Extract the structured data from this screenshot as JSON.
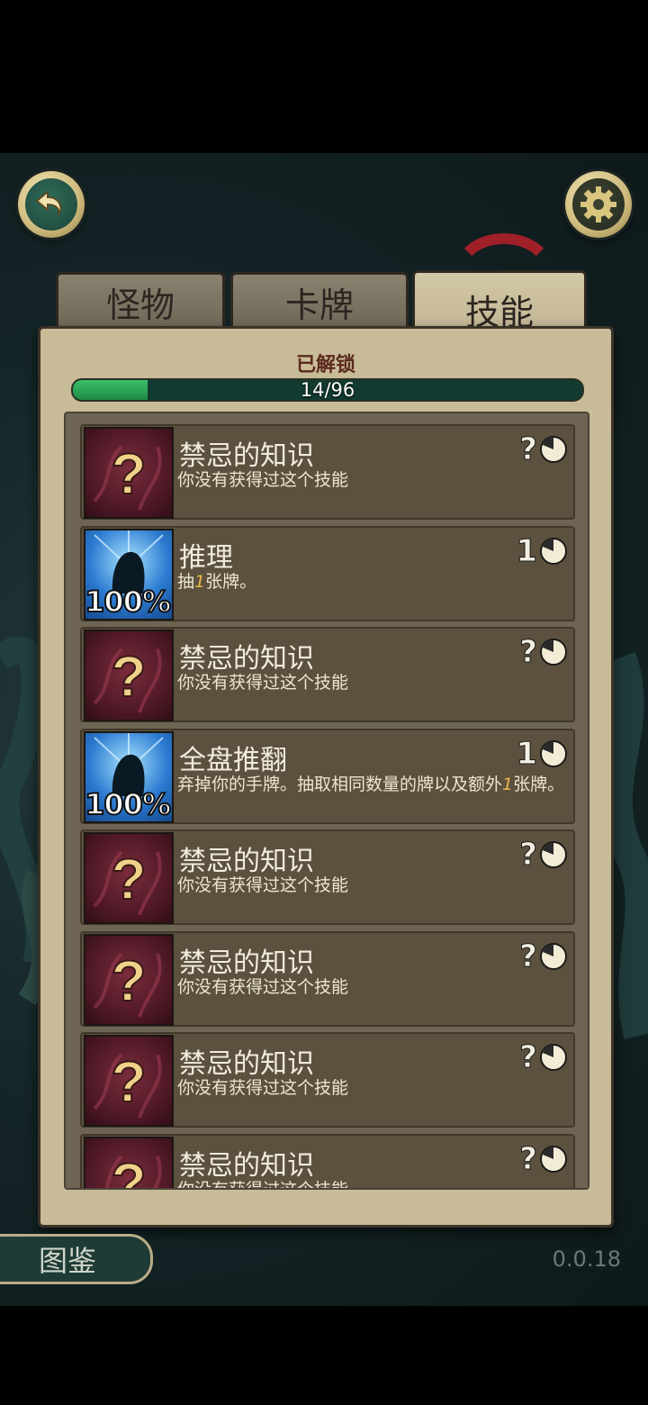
{
  "header": {
    "back_icon": "back-arrow-icon",
    "settings_icon": "gear-icon"
  },
  "tabs": [
    {
      "label": "怪物",
      "active": false
    },
    {
      "label": "卡牌",
      "active": false
    },
    {
      "label": "技能",
      "active": true
    }
  ],
  "unlock": {
    "label": "已解锁",
    "progress_text": "14/96",
    "progress_fraction": 0.146
  },
  "skills": [
    {
      "name": "禁忌的知识",
      "desc": "你没有获得过这个技能",
      "cost": "?",
      "locked": true
    },
    {
      "name": "推理",
      "desc_parts": [
        "抽",
        "1",
        "张牌。"
      ],
      "cost": "1",
      "percent": "100%",
      "locked": false
    },
    {
      "name": "禁忌的知识",
      "desc": "你没有获得过这个技能",
      "cost": "?",
      "locked": true
    },
    {
      "name": "全盘推翻",
      "desc_parts": [
        "弃掉你的手牌。抽取相同数量的牌以及额外",
        "1",
        "张牌。"
      ],
      "cost": "1",
      "percent": "100%",
      "locked": false
    },
    {
      "name": "禁忌的知识",
      "desc": "你没有获得过这个技能",
      "cost": "?",
      "locked": true
    },
    {
      "name": "禁忌的知识",
      "desc": "你没有获得过这个技能",
      "cost": "?",
      "locked": true
    },
    {
      "name": "禁忌的知识",
      "desc": "你没有获得过这个技能",
      "cost": "?",
      "locked": true
    },
    {
      "name": "禁忌的知识",
      "desc": "你没有获得过这个技能",
      "cost": "?",
      "locked": true
    }
  ],
  "footer": {
    "atlas_label": "图鉴",
    "version": "0.0.18"
  }
}
